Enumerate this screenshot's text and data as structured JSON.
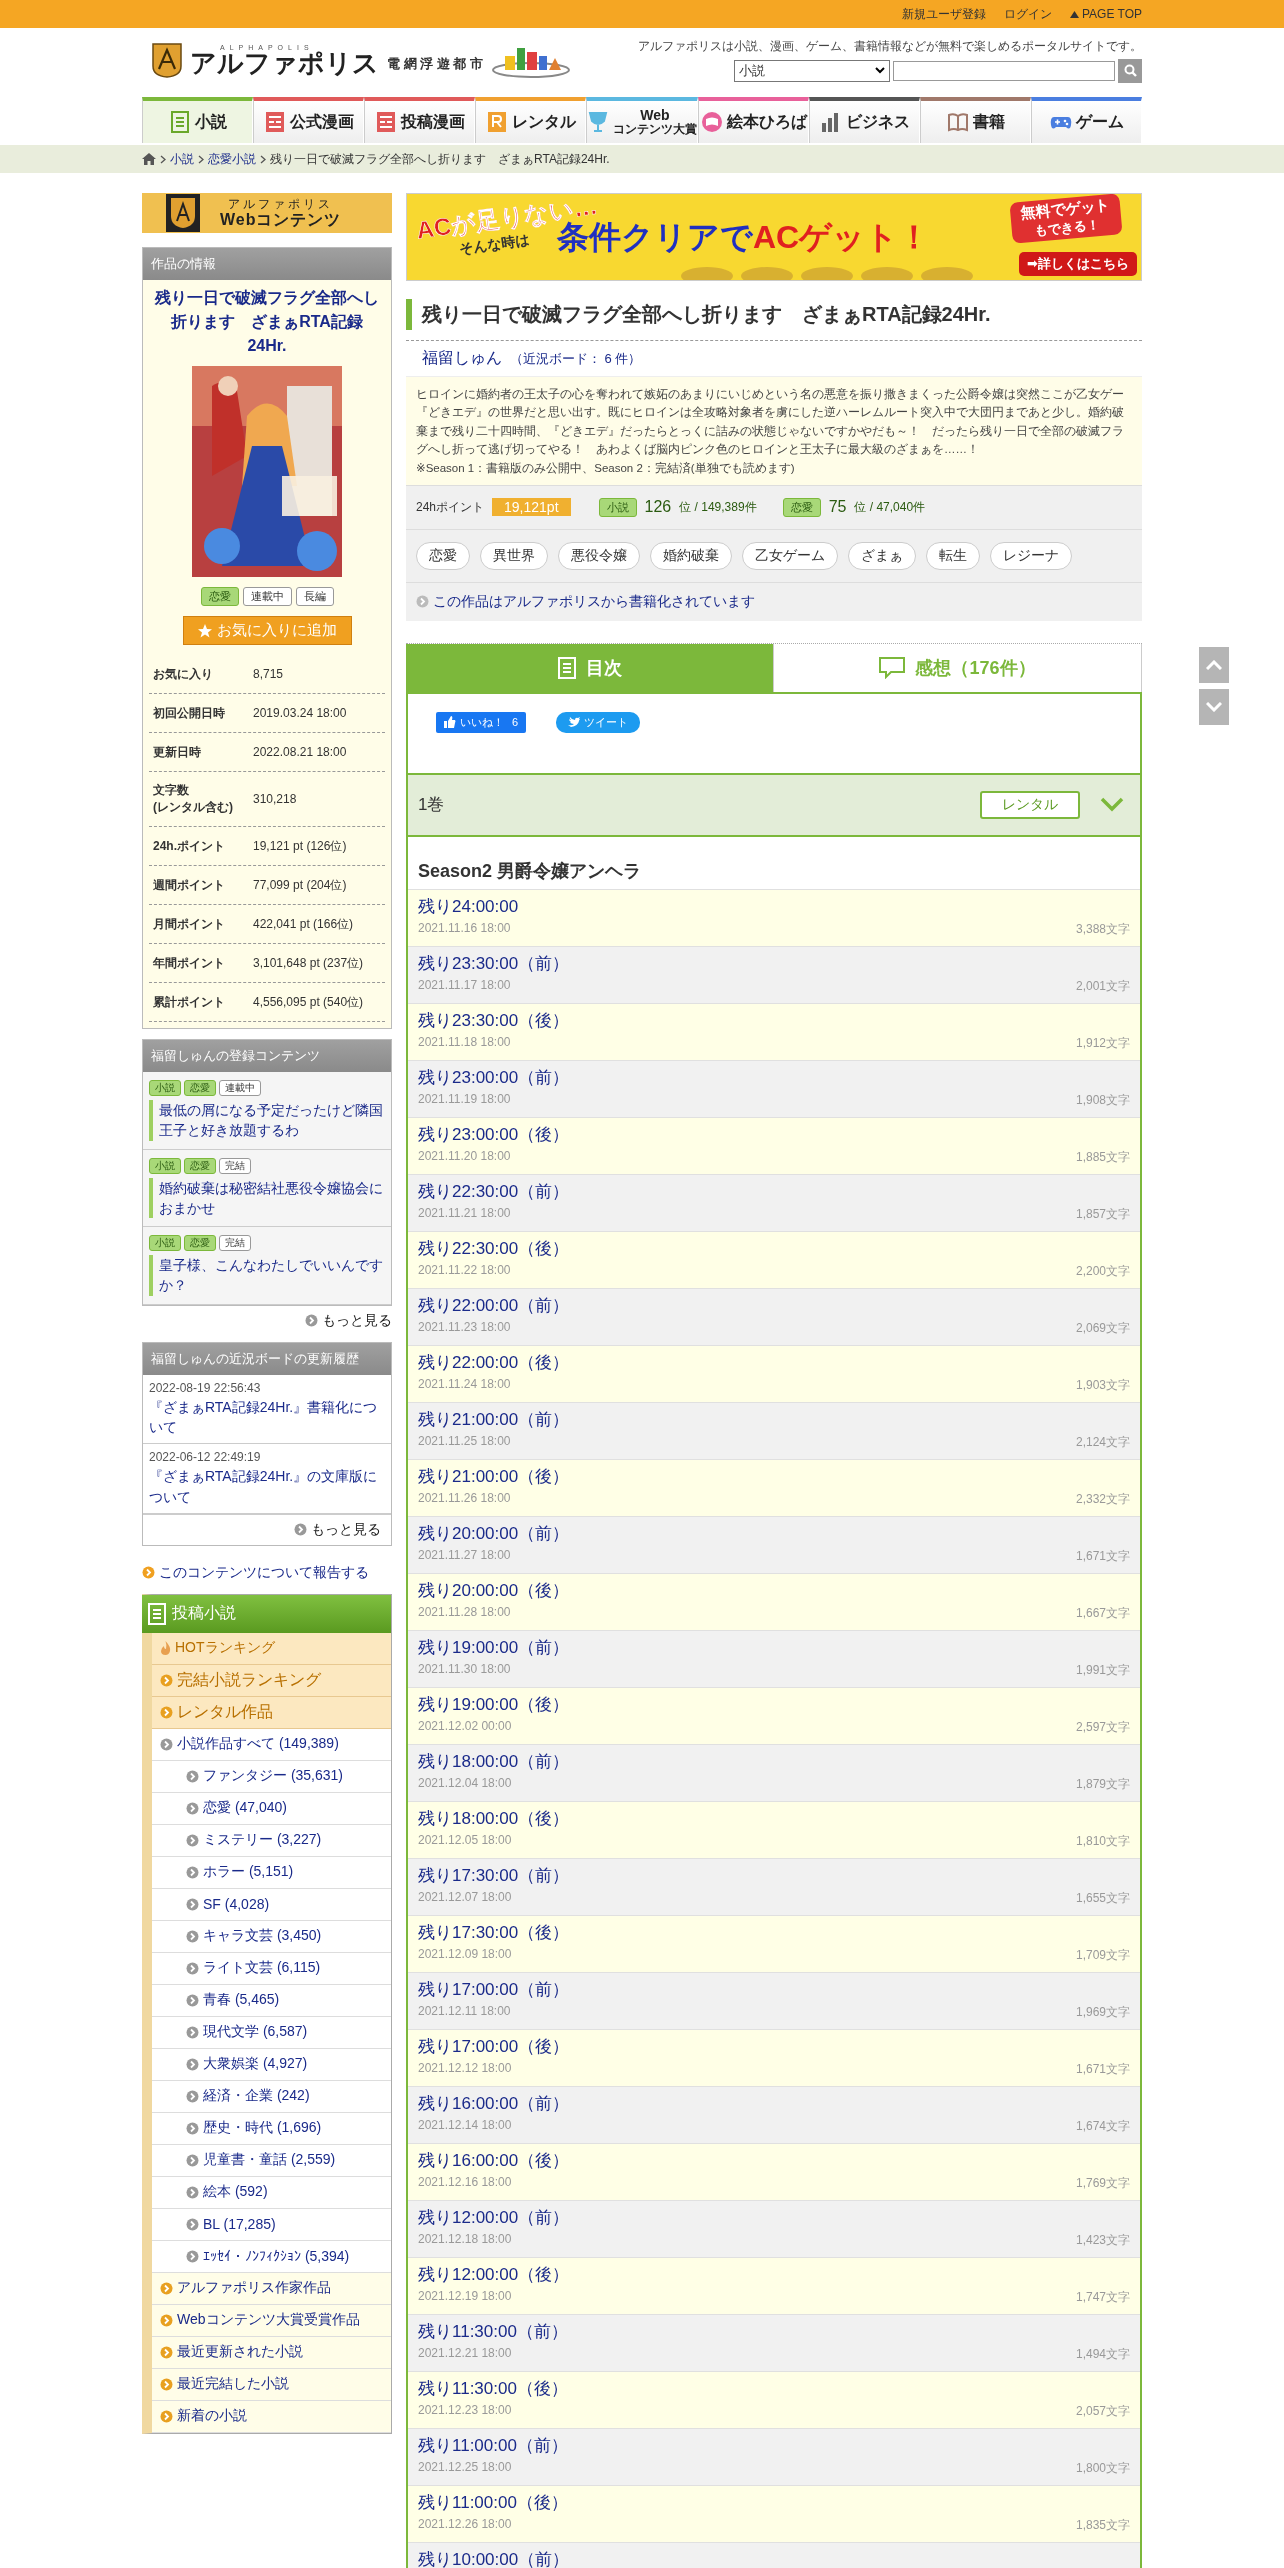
{
  "top_bar": {
    "links": [
      "新規ユーザ登録",
      "ログイン"
    ],
    "page_top": "PAGE TOP"
  },
  "header": {
    "logo_small": "ALPHAPOLIS",
    "logo": "アルファポリス",
    "logo_sub": "電 網 浮 遊 都 市",
    "tagline": "アルファポリスは小説、漫画、ゲーム、書籍情報などが無料で楽しめるポータルサイトです。",
    "search": {
      "category": "小説"
    }
  },
  "nav": [
    {
      "label": "小説",
      "selected": true,
      "color": "#7cb83b"
    },
    {
      "label": "公式漫画",
      "selected": false,
      "color": "#e05a5a"
    },
    {
      "label": "投稿漫画",
      "selected": false,
      "color": "#e05a5a"
    },
    {
      "label": "レンタル",
      "selected": false,
      "color": "#f0a030"
    },
    {
      "label": "Web",
      "sub": "コンテンツ大賞",
      "selected": false,
      "color": "#5bb8e0"
    },
    {
      "label": "絵本ひろば",
      "selected": false,
      "color": "#e8609a"
    },
    {
      "label": "ビジネス",
      "selected": false,
      "color": "#555555"
    },
    {
      "label": "書籍",
      "selected": false,
      "color": "#a0786a"
    },
    {
      "label": "ゲーム",
      "selected": false,
      "color": "#4a7ee0"
    }
  ],
  "breadcrumb": {
    "items": [
      "小説",
      "恋愛小説"
    ],
    "current": "残り一日で破滅フラグ全部へし折ります　ざまぁRTA記録24Hr."
  },
  "web_contents": {
    "line1": "アルファポリス",
    "line2": "Webコンテンツ"
  },
  "work_info": {
    "heading": "作品の情報",
    "title": "残り一日で破滅フラグ全部へし折ります　ざまぁRTA記録24Hr.",
    "tags": [
      {
        "label": "恋愛",
        "kind": "genre"
      },
      {
        "label": "連載中",
        "kind": "status"
      },
      {
        "label": "長編",
        "kind": "status"
      }
    ],
    "favorite_button": "お気に入りに追加",
    "stats": [
      {
        "label": "お気に入り",
        "value": "8,715"
      },
      {
        "label": "初回公開日時",
        "value": "2019.03.24 18:00"
      },
      {
        "label": "更新日時",
        "value": "2022.08.21 18:00"
      },
      {
        "label": "文字数",
        "note": "(レンタル含む)",
        "value": "310,218"
      },
      {
        "label": "24h.ポイント",
        "value": "19,121 pt (126位)"
      },
      {
        "label": "週間ポイント",
        "value": "77,099 pt (204位)"
      },
      {
        "label": "月間ポイント",
        "value": "422,041 pt (166位)"
      },
      {
        "label": "年間ポイント",
        "value": "3,101,648 pt (237位)"
      },
      {
        "label": "累計ポイント",
        "value": "4,556,095 pt (540位)"
      }
    ]
  },
  "author_works": {
    "heading": "福留しゅんの登録コンテンツ",
    "items": [
      {
        "tags": [
          {
            "label": "小説",
            "kind": "genre"
          },
          {
            "label": "恋愛",
            "kind": "genre"
          },
          {
            "label": "連載中",
            "kind": "status"
          }
        ],
        "title": "最低の屑になる予定だったけど隣国王子と好き放題するわ"
      },
      {
        "tags": [
          {
            "label": "小説",
            "kind": "genre"
          },
          {
            "label": "恋愛",
            "kind": "genre"
          },
          {
            "label": "完結",
            "kind": "status"
          }
        ],
        "title": "婚約破棄は秘密結社悪役令嬢協会におまかせ"
      },
      {
        "tags": [
          {
            "label": "小説",
            "kind": "genre"
          },
          {
            "label": "恋愛",
            "kind": "genre"
          },
          {
            "label": "完結",
            "kind": "status"
          }
        ],
        "title": "皇子様、こんなわたしでいいんですか？"
      }
    ],
    "more": "もっと見る"
  },
  "board_history": {
    "heading": "福留しゅんの近況ボードの更新履歴",
    "items": [
      {
        "time": "2022-08-19 22:56:43",
        "title": "『ざまぁRTA記録24Hr.』書籍化について"
      },
      {
        "time": "2022-06-12 22:49:19",
        "title": "『ざまぁRTA記録24Hr.』の文庫版について"
      }
    ],
    "more": "もっと見る"
  },
  "report_link": "このコンテンツについて報告する",
  "novel_menu": {
    "heading": "投稿小説",
    "items": [
      {
        "label": "HOTランキング",
        "kind": "hot"
      },
      {
        "label": "完結小説ランキング",
        "kind": "ranking"
      },
      {
        "label": "レンタル作品",
        "kind": "ranking"
      },
      {
        "label": "小説作品すべて (149,389)",
        "kind": "all",
        "children": [
          {
            "label": "ファンタジー (35,631)"
          },
          {
            "label": "恋愛 (47,040)"
          },
          {
            "label": "ミステリー (3,227)"
          },
          {
            "label": "ホラー (5,151)"
          },
          {
            "label": "SF (4,028)"
          },
          {
            "label": "キャラ文芸 (3,450)"
          },
          {
            "label": "ライト文芸 (6,115)"
          },
          {
            "label": "青春 (5,465)"
          },
          {
            "label": "現代文学 (6,587)"
          },
          {
            "label": "大衆娯楽 (4,927)"
          },
          {
            "label": "経済・企業 (242)"
          },
          {
            "label": "歴史・時代 (1,696)"
          },
          {
            "label": "児童書・童話 (2,559)"
          },
          {
            "label": "絵本 (592)"
          },
          {
            "label": "BL (17,285)"
          },
          {
            "label": "ｴｯｾｲ・ﾉﾝﾌｨｸｼｮﾝ (5,394)"
          }
        ]
      },
      {
        "label": "アルファポリス作家作品",
        "kind": "extra"
      },
      {
        "label": "Webコンテンツ大賞受賞作品",
        "kind": "extra"
      },
      {
        "label": "最近更新された小説",
        "kind": "extra"
      },
      {
        "label": "最近完結した小説",
        "kind": "extra"
      },
      {
        "label": "新着の小説",
        "kind": "extra"
      }
    ]
  },
  "banner": {
    "lead": "ACが足りない…",
    "lead2": "そんな時は",
    "headline_1": "条件クリアで",
    "headline_2": "ACゲット！",
    "burst": "無料でゲット",
    "burst2": "もできる！",
    "button": "➡詳しくはこちら"
  },
  "work": {
    "title": "残り一日で破滅フラグ全部へし折ります　ざまぁRTA記録24Hr.",
    "author": "福留しゅん",
    "board_link": "（近況ボード： 6 件）",
    "description": "ヒロインに婚約者の王太子の心を奪われて嫉妬のあまりにいじめという名の悪意を振り撒きまくった公爵令嬢は突然ここが乙女ゲー『どきエデ』の世界だと思い出す。既にヒロインは全攻略対象者を虜にした逆ハーレムルート突入中で大団円まであと少し。婚約破棄まで残り二十四時間、『どきエデ』だったらとっくに詰みの状態じゃないですかやだも～！　だったら残り一日で全部の破滅フラグへし折って逃げ切ってやる！　あわよくば脳内ピンク色のヒロインと王太子に最大級のざまぁを……！",
    "note": "※Season 1：書籍版のみ公開中、Season 2：完結済(単独でも読めます)"
  },
  "points": {
    "label": "24hポイント",
    "value": "19,121pt",
    "ranks": [
      {
        "tag": "小説",
        "rank": "126",
        "total": "位 / 149,389件"
      },
      {
        "tag": "恋愛",
        "rank": "75",
        "total": "位 / 47,040件"
      }
    ]
  },
  "genre_tags": [
    "恋愛",
    "異世界",
    "悪役令嬢",
    "婚約破棄",
    "乙女ゲーム",
    "ざまぁ",
    "転生",
    "レジーナ"
  ],
  "book_link": "この作品はアルファポリスから書籍化されています",
  "tabs": [
    {
      "label": "目次",
      "selected": true
    },
    {
      "label": "感想（176件）",
      "selected": false
    }
  ],
  "social": {
    "like": "いいね！",
    "like_count": "6",
    "tweet": "ツイート"
  },
  "volume": {
    "title": "1巻",
    "rental": "レンタル",
    "expanded": true
  },
  "section": "Season2 男爵令嬢アンヘラ",
  "episodes": [
    {
      "title": "残り24:00:00",
      "date": "2021.11.16 18:00",
      "chars": "3,388文字"
    },
    {
      "title": "残り23:30:00（前）",
      "date": "2021.11.17 18:00",
      "chars": "2,001文字"
    },
    {
      "title": "残り23:30:00（後）",
      "date": "2021.11.18 18:00",
      "chars": "1,912文字"
    },
    {
      "title": "残り23:00:00（前）",
      "date": "2021.11.19 18:00",
      "chars": "1,908文字"
    },
    {
      "title": "残り23:00:00（後）",
      "date": "2021.11.20 18:00",
      "chars": "1,885文字"
    },
    {
      "title": "残り22:30:00（前）",
      "date": "2021.11.21 18:00",
      "chars": "1,857文字"
    },
    {
      "title": "残り22:30:00（後）",
      "date": "2021.11.22 18:00",
      "chars": "2,200文字"
    },
    {
      "title": "残り22:00:00（前）",
      "date": "2021.11.23 18:00",
      "chars": "2,069文字"
    },
    {
      "title": "残り22:00:00（後）",
      "date": "2021.11.24 18:00",
      "chars": "1,903文字"
    },
    {
      "title": "残り21:00:00（前）",
      "date": "2021.11.25 18:00",
      "chars": "2,124文字"
    },
    {
      "title": "残り21:00:00（後）",
      "date": "2021.11.26 18:00",
      "chars": "2,332文字"
    },
    {
      "title": "残り20:00:00（前）",
      "date": "2021.11.27 18:00",
      "chars": "1,671文字"
    },
    {
      "title": "残り20:00:00（後）",
      "date": "2021.11.28 18:00",
      "chars": "1,667文字"
    },
    {
      "title": "残り19:00:00（前）",
      "date": "2021.11.30 18:00",
      "chars": "1,991文字"
    },
    {
      "title": "残り19:00:00（後）",
      "date": "2021.12.02 00:00",
      "chars": "2,597文字"
    },
    {
      "title": "残り18:00:00（前）",
      "date": "2021.12.04 18:00",
      "chars": "1,879文字"
    },
    {
      "title": "残り18:00:00（後）",
      "date": "2021.12.05 18:00",
      "chars": "1,810文字"
    },
    {
      "title": "残り17:30:00（前）",
      "date": "2021.12.07 18:00",
      "chars": "1,655文字"
    },
    {
      "title": "残り17:30:00（後）",
      "date": "2021.12.09 18:00",
      "chars": "1,709文字"
    },
    {
      "title": "残り17:00:00（前）",
      "date": "2021.12.11 18:00",
      "chars": "1,969文字"
    },
    {
      "title": "残り17:00:00（後）",
      "date": "2021.12.12 18:00",
      "chars": "1,671文字"
    },
    {
      "title": "残り16:00:00（前）",
      "date": "2021.12.14 18:00",
      "chars": "1,674文字"
    },
    {
      "title": "残り16:00:00（後）",
      "date": "2021.12.16 18:00",
      "chars": "1,769文字"
    },
    {
      "title": "残り12:00:00（前）",
      "date": "2021.12.18 18:00",
      "chars": "1,423文字"
    },
    {
      "title": "残り12:00:00（後）",
      "date": "2021.12.19 18:00",
      "chars": "1,747文字"
    },
    {
      "title": "残り11:30:00（前）",
      "date": "2021.12.21 18:00",
      "chars": "1,494文字"
    },
    {
      "title": "残り11:30:00（後）",
      "date": "2021.12.23 18:00",
      "chars": "2,057文字"
    },
    {
      "title": "残り11:00:00（前）",
      "date": "2021.12.25 18:00",
      "chars": "1,800文字"
    },
    {
      "title": "残り11:00:00（後）",
      "date": "2021.12.26 18:00",
      "chars": "1,835文字"
    },
    {
      "title": "残り10:00:00（前）"
    }
  ]
}
